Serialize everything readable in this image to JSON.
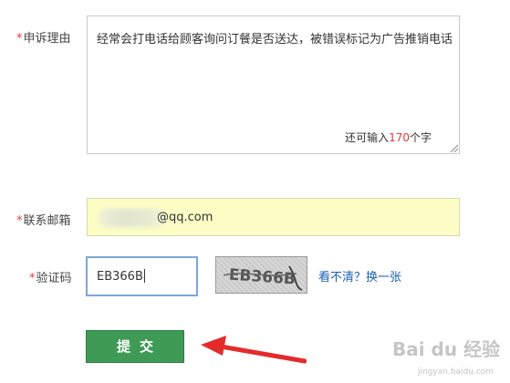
{
  "form": {
    "reason": {
      "required_mark": "*",
      "label": "申诉理由",
      "value": "经常会打电话给顾客询问订餐是否送达，被错误标记为广告推销电话",
      "counter_prefix": "还可输入",
      "counter_value": "170",
      "counter_suffix": "个字"
    },
    "email": {
      "required_mark": "*",
      "label": "联系邮箱",
      "value": "@qq.com"
    },
    "captcha": {
      "required_mark": "*",
      "label": "验证码",
      "value": "EB366B",
      "image_text": "EB366B",
      "refresh_link": "看不清？换一张"
    },
    "submit_label": "提交"
  },
  "watermark": {
    "brand": "Bai du 经验",
    "url": "jingyan.baidu.com"
  }
}
